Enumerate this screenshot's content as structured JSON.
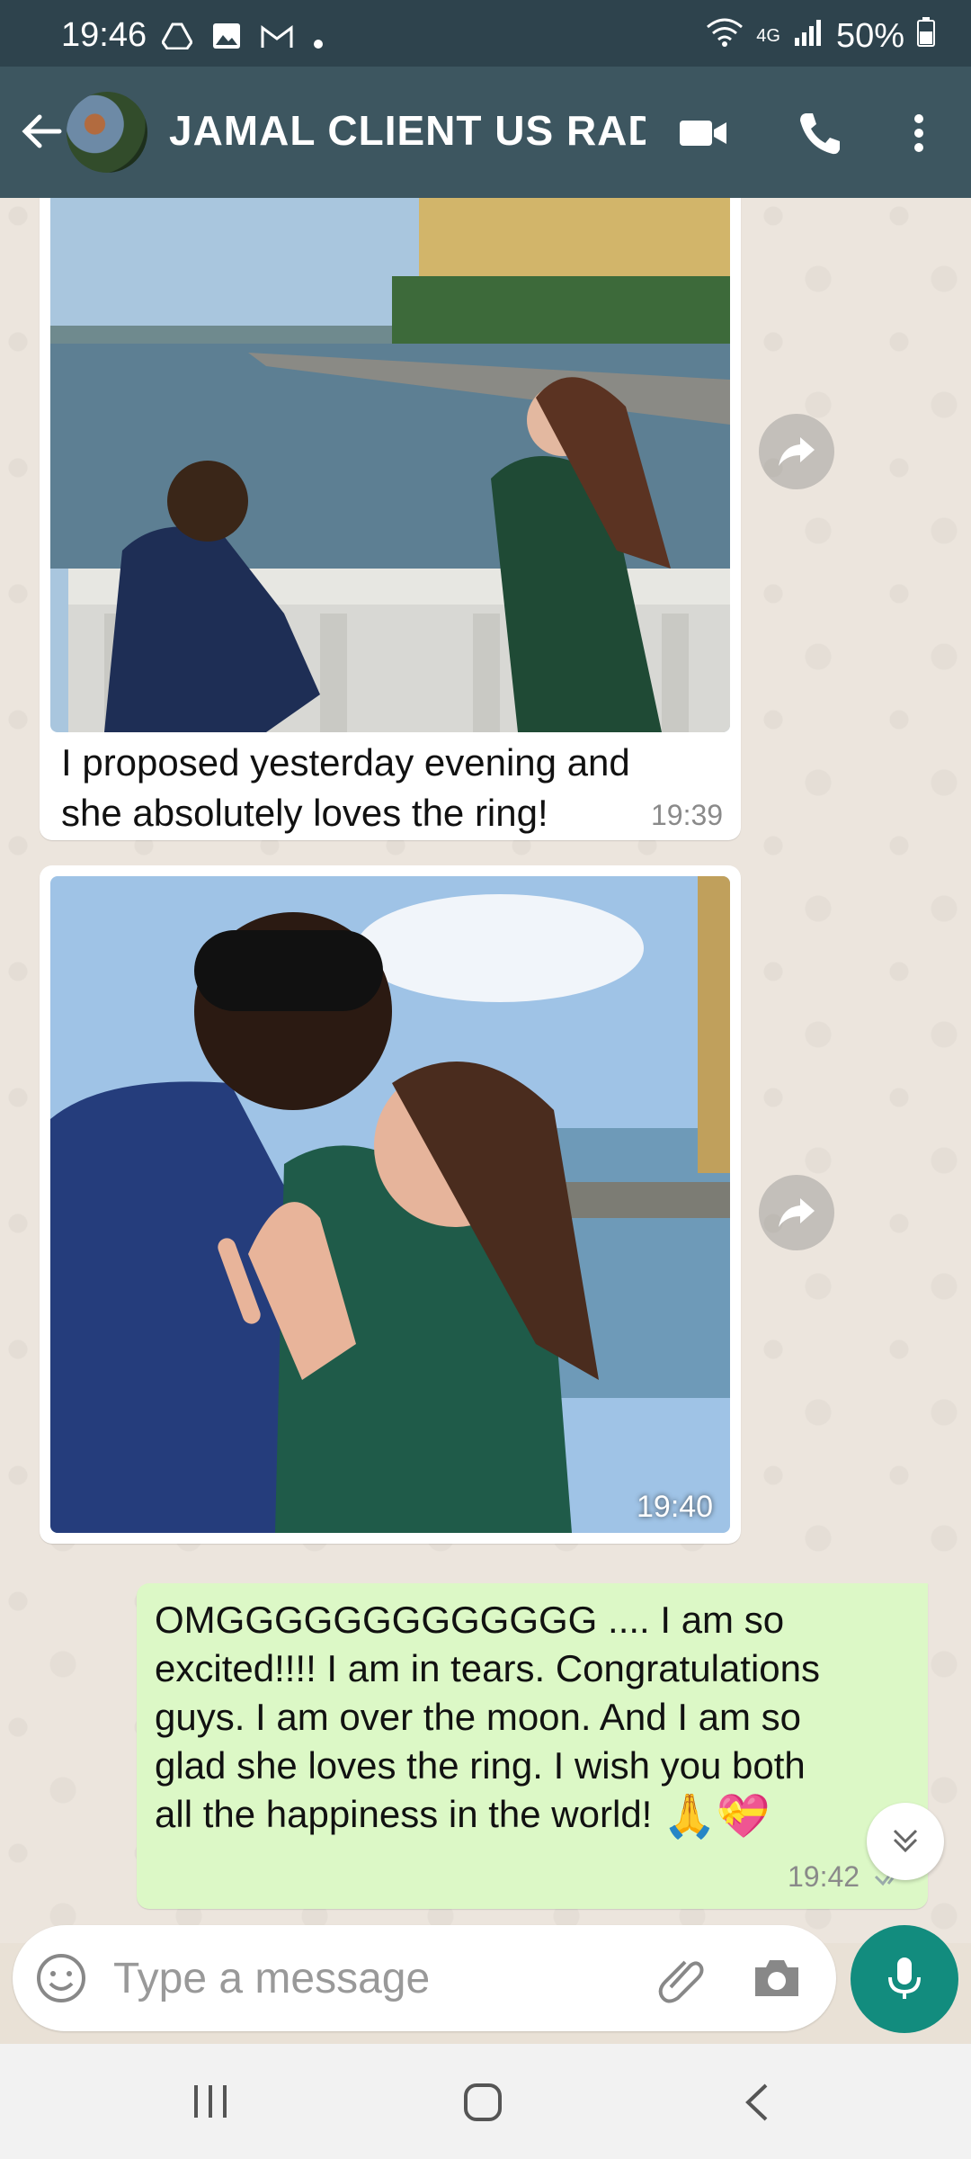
{
  "status_bar": {
    "time": "19:46",
    "network": "4G",
    "battery": "50%",
    "icons": [
      "drive-icon",
      "gallery-icon",
      "gmail-icon",
      "dot-icon",
      "wifi-icon",
      "signal-icon",
      "battery-icon"
    ]
  },
  "header": {
    "title": "JAMAL CLIENT US RAD...",
    "icons": [
      "back-arrow-icon",
      "video-call-icon",
      "phone-icon",
      "more-vert-icon"
    ]
  },
  "messages": [
    {
      "type": "image_with_caption",
      "caption_line1": "I proposed yesterday evening and",
      "caption_line2": "she absolutely loves the ring!",
      "time": "19:39"
    },
    {
      "type": "image",
      "time": "19:40"
    },
    {
      "type": "text_outgoing",
      "line1": "OMGGGGGGGGGGGGG .... I am so",
      "line2": "excited!!!! I am in tears. Congratulations",
      "line3": "guys. I am over the moon. And I am so",
      "line4": "glad she loves the ring. I wish you both",
      "line5": "all the happiness in the world!",
      "emoji": "🙏💝",
      "time": "19:42"
    }
  ],
  "composer": {
    "placeholder": "Type a message",
    "icons": [
      "emoji-icon",
      "attach-icon",
      "camera-icon",
      "mic-icon"
    ]
  },
  "colors": {
    "header": "#3d5660",
    "outgoing_bubble": "#dcf8c6",
    "accent": "#128c7e"
  }
}
